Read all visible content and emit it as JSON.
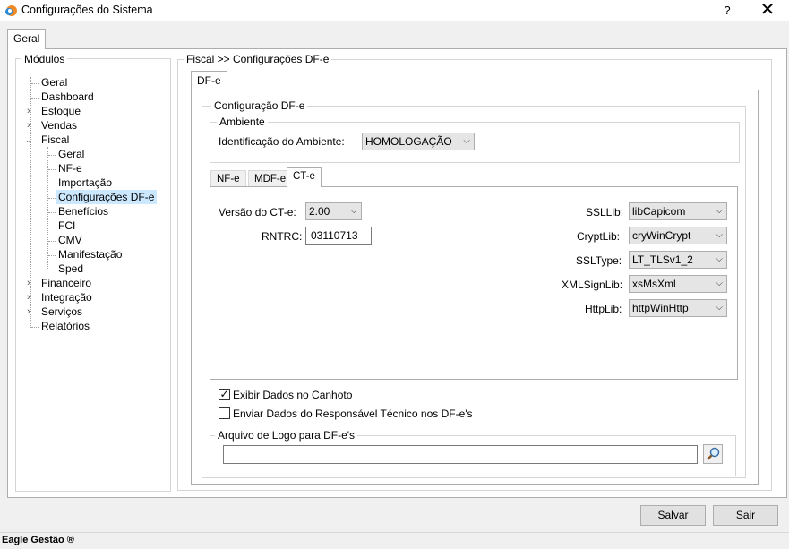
{
  "window": {
    "title": "Configurações do Sistema",
    "help_label": "?",
    "close_label": "✕"
  },
  "outer_tab": {
    "label": "Geral"
  },
  "modulos": {
    "legend": "Módulos",
    "tree": [
      {
        "label": "Geral"
      },
      {
        "label": "Dashboard"
      },
      {
        "label": "Estoque"
      },
      {
        "label": "Vendas"
      },
      {
        "label": "Fiscal"
      },
      {
        "label": "Geral"
      },
      {
        "label": "NF-e"
      },
      {
        "label": "Importação"
      },
      {
        "label": "Configurações DF-e"
      },
      {
        "label": "Benefícios"
      },
      {
        "label": "FCI"
      },
      {
        "label": "CMV"
      },
      {
        "label": "Manifestação"
      },
      {
        "label": "Sped"
      },
      {
        "label": "Financeiro"
      },
      {
        "label": "Integração"
      },
      {
        "label": "Serviços"
      },
      {
        "label": "Relatórios"
      }
    ]
  },
  "fiscal": {
    "breadcrumb": "Fiscal >> Configurações DF-e",
    "tab_dfe": "DF-e",
    "config_legend": "Configuração DF-e",
    "ambiente": {
      "legend": "Ambiente",
      "label": "Identificação do Ambiente:",
      "value": "HOMOLOGAÇÃO"
    },
    "inner_tabs": [
      "NF-e",
      "MDF-e",
      "CT-e"
    ],
    "versao_label": "Versão do CT-e:",
    "versao_value": "2.00",
    "rntrc_label": "RNTRC:",
    "rntrc_value": "03110713",
    "ssllib_label": "SSLLib:",
    "ssllib_value": "libCapicom",
    "cryptlib_label": "CryptLib:",
    "cryptlib_value": "cryWinCrypt",
    "ssltype_label": "SSLType:",
    "ssltype_value": "LT_TLSv1_2",
    "xmlsignlib_label": "XMLSignLib:",
    "xmlsignlib_value": "xsMsXml",
    "httplib_label": "HttpLib:",
    "httplib_value": "httpWinHttp",
    "exibir_canhoto": "Exibir Dados no Canhoto",
    "exibir_canhoto_checked": "✓",
    "enviar_resp": "Enviar Dados do Responsável Técnico nos DF-e's",
    "logo_legend": "Arquivo de Logo para DF-e's",
    "logo_value": ""
  },
  "buttons": {
    "save": "Salvar",
    "exit": "Sair"
  },
  "status": {
    "text": "Eagle Gestão ®"
  }
}
